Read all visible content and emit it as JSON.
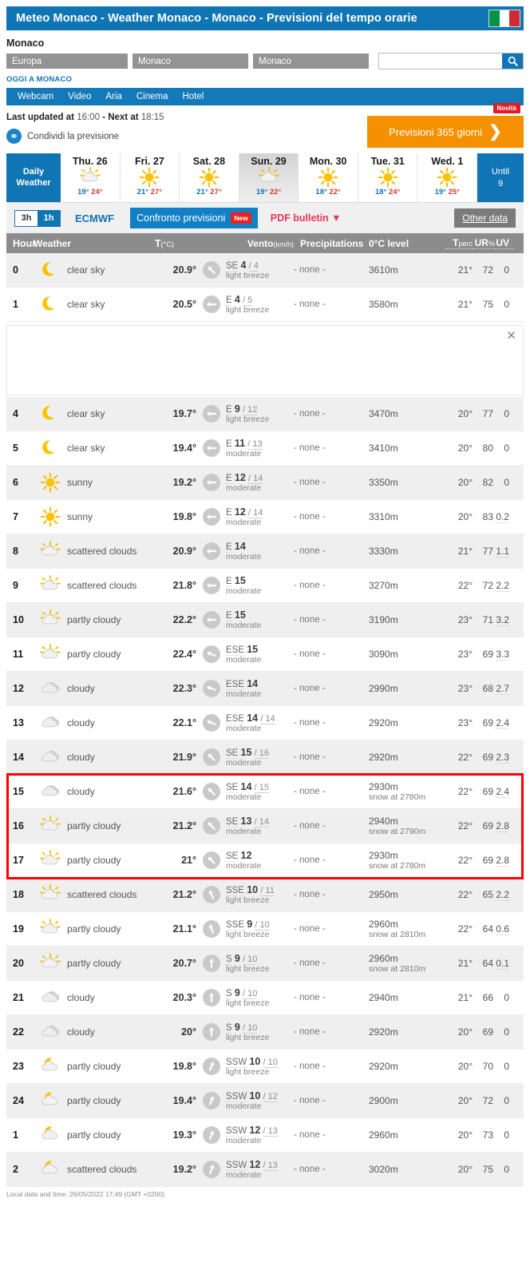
{
  "header": {
    "title": "Meteo Monaco - Weather Monaco - Monaco - Previsioni del tempo orarie",
    "flag_icon": "italy-flag-icon"
  },
  "location": {
    "name": "Monaco",
    "continent_select": "Europa",
    "country_select": "Monaco",
    "city_select": "Monaco",
    "search_value": "",
    "search_placeholder": "",
    "search_icon": "search-icon",
    "today_label": "OGGI A MONACO"
  },
  "nav": {
    "items": [
      {
        "label": "Webcam"
      },
      {
        "label": "Video"
      },
      {
        "label": "Aria"
      },
      {
        "label": "Cinema"
      },
      {
        "label": "Hotel"
      }
    ]
  },
  "status": {
    "updated_prefix": "Last updated at",
    "updated_time": "16:00",
    "next_prefix": "- Next at",
    "next_time": "18:15",
    "share_label": "Condividi la previsione",
    "share_icon": "globe-share-icon"
  },
  "promo": {
    "label": "Previsioni 365 giorni",
    "badge": "Novità",
    "chevron_icon": "chevron-right-icon",
    "color": "#f59100"
  },
  "daily": {
    "head_line1": "Daily",
    "head_line2": "Weather",
    "until_line1": "Until",
    "until_line2": "9",
    "days": [
      {
        "name": "Thu. 26",
        "icon": "sun-cloud-icon",
        "min": "19°",
        "max": "24°",
        "active": false
      },
      {
        "name": "Fri. 27",
        "icon": "sun-icon",
        "min": "21°",
        "max": "27°",
        "active": false
      },
      {
        "name": "Sat. 28",
        "icon": "sun-icon",
        "min": "21°",
        "max": "27°",
        "active": false
      },
      {
        "name": "Sun. 29",
        "icon": "sun-cloud-icon",
        "min": "19°",
        "max": "22°",
        "active": true
      },
      {
        "name": "Mon. 30",
        "icon": "sun-icon",
        "min": "18°",
        "max": "22°",
        "active": false
      },
      {
        "name": "Tue. 31",
        "icon": "sun-icon",
        "min": "18°",
        "max": "24°",
        "active": false
      },
      {
        "name": "Wed. 1",
        "icon": "sun-icon",
        "min": "19°",
        "max": "25°",
        "active": false
      }
    ]
  },
  "toolbar": {
    "hours_3h": "3h",
    "hours_1h": "1h",
    "model": "ECMWF",
    "compare": "Confronto previsioni",
    "compare_badge": "New",
    "pdf": "PDF bulletin ▼",
    "other_data": "Other data",
    "accent_blue": "#1075b4",
    "pdf_color": "#e8365a"
  },
  "table": {
    "columns": {
      "hour": "Hour",
      "weather": "Weather",
      "temp": "T",
      "temp_unit": "(°C)",
      "wind": "Vento",
      "wind_unit": "(km/h)",
      "precip": "Precipitations",
      "zero_level": "0°C level",
      "tperc": "T",
      "tperc_sub": "perc",
      "ur": "UR",
      "ur_sub": "%",
      "uv": "UV"
    },
    "ad": {
      "close_icon": "close-icon"
    },
    "highlight_color": "#ff0000",
    "rows": [
      {
        "hour": "0",
        "icon": "moon-icon",
        "desc": "clear sky",
        "temp": "20.9°",
        "wind_dir": "SE",
        "wind_speed": "4",
        "wind_gust": "4",
        "wind_desc": "light breeze",
        "wind_angle": 315,
        "precip": "- none -",
        "zero": "3610m",
        "snow": "",
        "tperc": "21°",
        "ur": "72",
        "uv": "0",
        "alt": true
      },
      {
        "hour": "1",
        "icon": "moon-icon",
        "desc": "clear sky",
        "temp": "20.5°",
        "wind_dir": "E",
        "wind_speed": "4",
        "wind_gust": "5",
        "wind_desc": "light breeze",
        "wind_angle": 270,
        "precip": "- none -",
        "zero": "3580m",
        "snow": "",
        "tperc": "21°",
        "ur": "75",
        "uv": "0",
        "alt": false
      },
      {
        "hour": "4",
        "icon": "moon-icon",
        "desc": "clear sky",
        "temp": "19.7°",
        "wind_dir": "E",
        "wind_speed": "9",
        "wind_gust": "12",
        "wind_desc": "light breeze",
        "wind_angle": 270,
        "precip": "- none -",
        "zero": "3470m",
        "snow": "",
        "tperc": "20°",
        "ur": "77",
        "uv": "0",
        "alt": true
      },
      {
        "hour": "5",
        "icon": "moon-icon",
        "desc": "clear sky",
        "temp": "19.4°",
        "wind_dir": "E",
        "wind_speed": "11",
        "wind_gust": "13",
        "wind_desc": "moderate",
        "wind_angle": 270,
        "precip": "- none -",
        "zero": "3410m",
        "snow": "",
        "tperc": "20°",
        "ur": "80",
        "uv": "0",
        "alt": false
      },
      {
        "hour": "6",
        "icon": "sun-icon",
        "desc": "sunny",
        "temp": "19.2°",
        "wind_dir": "E",
        "wind_speed": "12",
        "wind_gust": "14",
        "wind_desc": "moderate",
        "wind_angle": 270,
        "precip": "- none -",
        "zero": "3350m",
        "snow": "",
        "tperc": "20°",
        "ur": "82",
        "uv": "0",
        "alt": true
      },
      {
        "hour": "7",
        "icon": "sun-icon",
        "desc": "sunny",
        "temp": "19.8°",
        "wind_dir": "E",
        "wind_speed": "12",
        "wind_gust": "14",
        "wind_desc": "moderate",
        "wind_angle": 270,
        "precip": "- none -",
        "zero": "3310m",
        "snow": "",
        "tperc": "20°",
        "ur": "83",
        "uv": "0.2",
        "alt": false
      },
      {
        "hour": "8",
        "icon": "sun-cloud-icon",
        "desc": "scattered clouds",
        "temp": "20.9°",
        "wind_dir": "E",
        "wind_speed": "14",
        "wind_gust": "",
        "wind_desc": "moderate",
        "wind_angle": 270,
        "precip": "- none -",
        "zero": "3330m",
        "snow": "",
        "tperc": "21°",
        "ur": "77",
        "uv": "1.1",
        "alt": true
      },
      {
        "hour": "9",
        "icon": "sun-cloud-icon",
        "desc": "scattered clouds",
        "temp": "21.8°",
        "wind_dir": "E",
        "wind_speed": "15",
        "wind_gust": "",
        "wind_desc": "moderate",
        "wind_angle": 270,
        "precip": "- none -",
        "zero": "3270m",
        "snow": "",
        "tperc": "22°",
        "ur": "72",
        "uv": "2.2",
        "alt": false
      },
      {
        "hour": "10",
        "icon": "sun-cloud-icon",
        "desc": "partly cloudy",
        "temp": "22.2°",
        "wind_dir": "E",
        "wind_speed": "15",
        "wind_gust": "",
        "wind_desc": "moderate",
        "wind_angle": 270,
        "precip": "- none -",
        "zero": "3190m",
        "snow": "",
        "tperc": "23°",
        "ur": "71",
        "uv": "3.2",
        "alt": true
      },
      {
        "hour": "11",
        "icon": "sun-cloud-icon",
        "desc": "partly cloudy",
        "temp": "22.4°",
        "wind_dir": "ESE",
        "wind_speed": "15",
        "wind_gust": "",
        "wind_desc": "moderate",
        "wind_angle": 292,
        "precip": "- none -",
        "zero": "3090m",
        "snow": "",
        "tperc": "23°",
        "ur": "69",
        "uv": "3.3",
        "alt": false
      },
      {
        "hour": "12",
        "icon": "cloud-icon",
        "desc": "cloudy",
        "temp": "22.3°",
        "wind_dir": "ESE",
        "wind_speed": "14",
        "wind_gust": "",
        "wind_desc": "moderate",
        "wind_angle": 292,
        "precip": "- none -",
        "zero": "2990m",
        "snow": "",
        "tperc": "23°",
        "ur": "68",
        "uv": "2.7",
        "alt": true
      },
      {
        "hour": "13",
        "icon": "cloud-icon",
        "desc": "cloudy",
        "temp": "22.1°",
        "wind_dir": "ESE",
        "wind_speed": "14",
        "wind_gust": "14",
        "wind_desc": "moderate",
        "wind_angle": 292,
        "precip": "- none -",
        "zero": "2920m",
        "snow": "",
        "tperc": "23°",
        "ur": "69",
        "uv": "2.4",
        "alt": false
      },
      {
        "hour": "14",
        "icon": "cloud-icon",
        "desc": "cloudy",
        "temp": "21.9°",
        "wind_dir": "SE",
        "wind_speed": "15",
        "wind_gust": "16",
        "wind_desc": "moderate",
        "wind_angle": 315,
        "precip": "- none -",
        "zero": "2920m",
        "snow": "",
        "tperc": "22°",
        "ur": "69",
        "uv": "2.3",
        "alt": true
      },
      {
        "hour": "15",
        "icon": "cloud-icon",
        "desc": "cloudy",
        "temp": "21.6°",
        "wind_dir": "SE",
        "wind_speed": "14",
        "wind_gust": "15",
        "wind_desc": "moderate",
        "wind_angle": 315,
        "precip": "- none -",
        "zero": "2930m",
        "snow": "snow at 2780m",
        "tperc": "22°",
        "ur": "69",
        "uv": "2.4",
        "alt": false
      },
      {
        "hour": "16",
        "icon": "sun-cloud-icon",
        "desc": "partly cloudy",
        "temp": "21.2°",
        "wind_dir": "SE",
        "wind_speed": "13",
        "wind_gust": "14",
        "wind_desc": "moderate",
        "wind_angle": 315,
        "precip": "- none -",
        "zero": "2940m",
        "snow": "snow at 2790m",
        "tperc": "22°",
        "ur": "69",
        "uv": "2.8",
        "alt": true
      },
      {
        "hour": "17",
        "icon": "sun-cloud-icon",
        "desc": "partly cloudy",
        "temp": "21°",
        "wind_dir": "SE",
        "wind_speed": "12",
        "wind_gust": "",
        "wind_desc": "moderate",
        "wind_angle": 315,
        "precip": "- none -",
        "zero": "2930m",
        "snow": "snow at 2780m",
        "tperc": "22°",
        "ur": "69",
        "uv": "2.8",
        "alt": false
      },
      {
        "hour": "18",
        "icon": "sun-cloud-icon",
        "desc": "scattered clouds",
        "temp": "21.2°",
        "wind_dir": "SSE",
        "wind_speed": "10",
        "wind_gust": "11",
        "wind_desc": "light breeze",
        "wind_angle": 337,
        "precip": "- none -",
        "zero": "2950m",
        "snow": "",
        "tperc": "22°",
        "ur": "65",
        "uv": "2.2",
        "alt": true
      },
      {
        "hour": "19",
        "icon": "sun-cloud-icon",
        "desc": "partly cloudy",
        "temp": "21.1°",
        "wind_dir": "SSE",
        "wind_speed": "9",
        "wind_gust": "10",
        "wind_desc": "light breeze",
        "wind_angle": 337,
        "precip": "- none -",
        "zero": "2960m",
        "snow": "snow at 2810m",
        "tperc": "22°",
        "ur": "64",
        "uv": "0.6",
        "alt": false
      },
      {
        "hour": "20",
        "icon": "sun-cloud-icon",
        "desc": "partly cloudy",
        "temp": "20.7°",
        "wind_dir": "S",
        "wind_speed": "9",
        "wind_gust": "10",
        "wind_desc": "light breeze",
        "wind_angle": 0,
        "precip": "- none -",
        "zero": "2960m",
        "snow": "snow at 2810m",
        "tperc": "21°",
        "ur": "64",
        "uv": "0.1",
        "alt": true
      },
      {
        "hour": "21",
        "icon": "cloud-icon",
        "desc": "cloudy",
        "temp": "20.3°",
        "wind_dir": "S",
        "wind_speed": "9",
        "wind_gust": "10",
        "wind_desc": "light breeze",
        "wind_angle": 0,
        "precip": "- none -",
        "zero": "2940m",
        "snow": "",
        "tperc": "21°",
        "ur": "66",
        "uv": "0",
        "alt": false
      },
      {
        "hour": "22",
        "icon": "cloud-icon",
        "desc": "cloudy",
        "temp": "20°",
        "wind_dir": "S",
        "wind_speed": "9",
        "wind_gust": "10",
        "wind_desc": "light breeze",
        "wind_angle": 0,
        "precip": "- none -",
        "zero": "2920m",
        "snow": "",
        "tperc": "20°",
        "ur": "69",
        "uv": "0",
        "alt": true
      },
      {
        "hour": "23",
        "icon": "moon-cloud-icon",
        "desc": "partly cloudy",
        "temp": "19.8°",
        "wind_dir": "SSW",
        "wind_speed": "10",
        "wind_gust": "10",
        "wind_desc": "light breeze",
        "wind_angle": 22,
        "precip": "- none -",
        "zero": "2920m",
        "snow": "",
        "tperc": "20°",
        "ur": "70",
        "uv": "0",
        "alt": false
      },
      {
        "hour": "24",
        "icon": "moon-cloud-icon",
        "desc": "partly cloudy",
        "temp": "19.4°",
        "wind_dir": "SSW",
        "wind_speed": "10",
        "wind_gust": "12",
        "wind_desc": "moderate",
        "wind_angle": 22,
        "precip": "- none -",
        "zero": "2900m",
        "snow": "",
        "tperc": "20°",
        "ur": "72",
        "uv": "0",
        "alt": true
      },
      {
        "hour": "1",
        "icon": "moon-cloud-icon",
        "desc": "partly cloudy",
        "temp": "19.3°",
        "wind_dir": "SSW",
        "wind_speed": "12",
        "wind_gust": "13",
        "wind_desc": "moderate",
        "wind_angle": 22,
        "precip": "- none -",
        "zero": "2960m",
        "snow": "",
        "tperc": "20°",
        "ur": "73",
        "uv": "0",
        "alt": false
      },
      {
        "hour": "2",
        "icon": "moon-cloud-icon",
        "desc": "scattered clouds",
        "temp": "19.2°",
        "wind_dir": "SSW",
        "wind_speed": "12",
        "wind_gust": "13",
        "wind_desc": "moderate",
        "wind_angle": 22,
        "precip": "- none -",
        "zero": "3020m",
        "snow": "",
        "tperc": "20°",
        "ur": "75",
        "uv": "0",
        "alt": true
      }
    ]
  },
  "footer": {
    "text": "Local data and time: 26/05/2022 17:49 (GMT +0200)"
  }
}
